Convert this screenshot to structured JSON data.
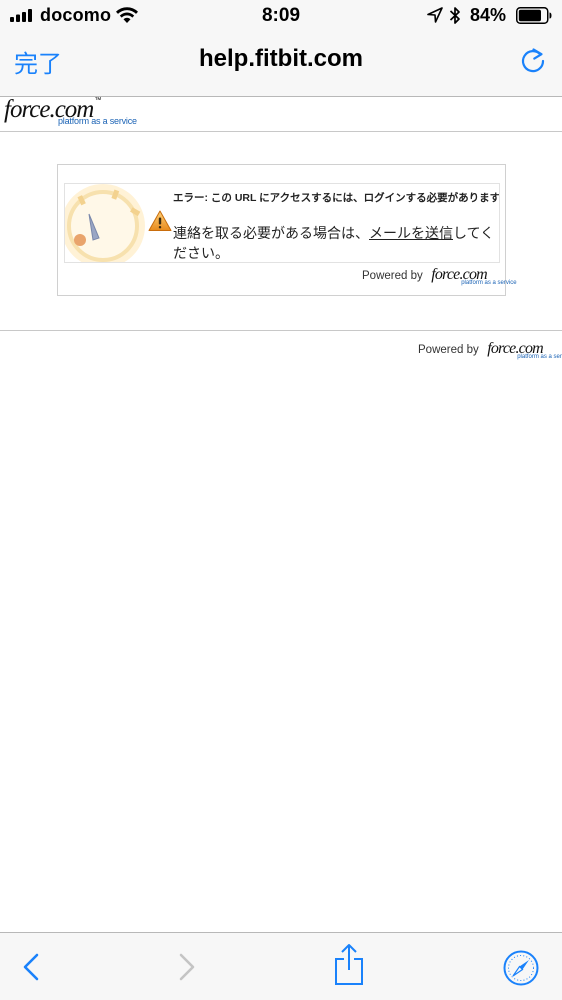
{
  "status_bar": {
    "carrier": "docomo",
    "time": "8:09",
    "battery_percent": "84%",
    "battery_level": 0.84,
    "icons": [
      "signal-icon",
      "wifi-icon",
      "location-arrow-icon",
      "bluetooth-icon",
      "battery-icon"
    ]
  },
  "nav": {
    "done_label": "完了",
    "title": "help.fitbit.com",
    "reload_icon": "reload-icon"
  },
  "header": {
    "logo_text": "force.com",
    "logo_tagline": "platform as a service"
  },
  "error": {
    "title": "エラー: この URL にアクセスするには、ログインする必要があります。",
    "message_prefix": "連絡を取る必要がある場合は、",
    "link_text": "メールを送信",
    "message_suffix": "してください。",
    "warning_icon": "warning-icon"
  },
  "powered": {
    "text": "Powered by",
    "logo_text": "force.com",
    "logo_tagline": "platform as a service"
  },
  "toolbar": {
    "icons": [
      "back-icon",
      "forward-icon",
      "share-icon",
      "safari-compass-icon"
    ],
    "accent_color": "#1a82fb",
    "disabled_color": "#c4c4c4"
  }
}
